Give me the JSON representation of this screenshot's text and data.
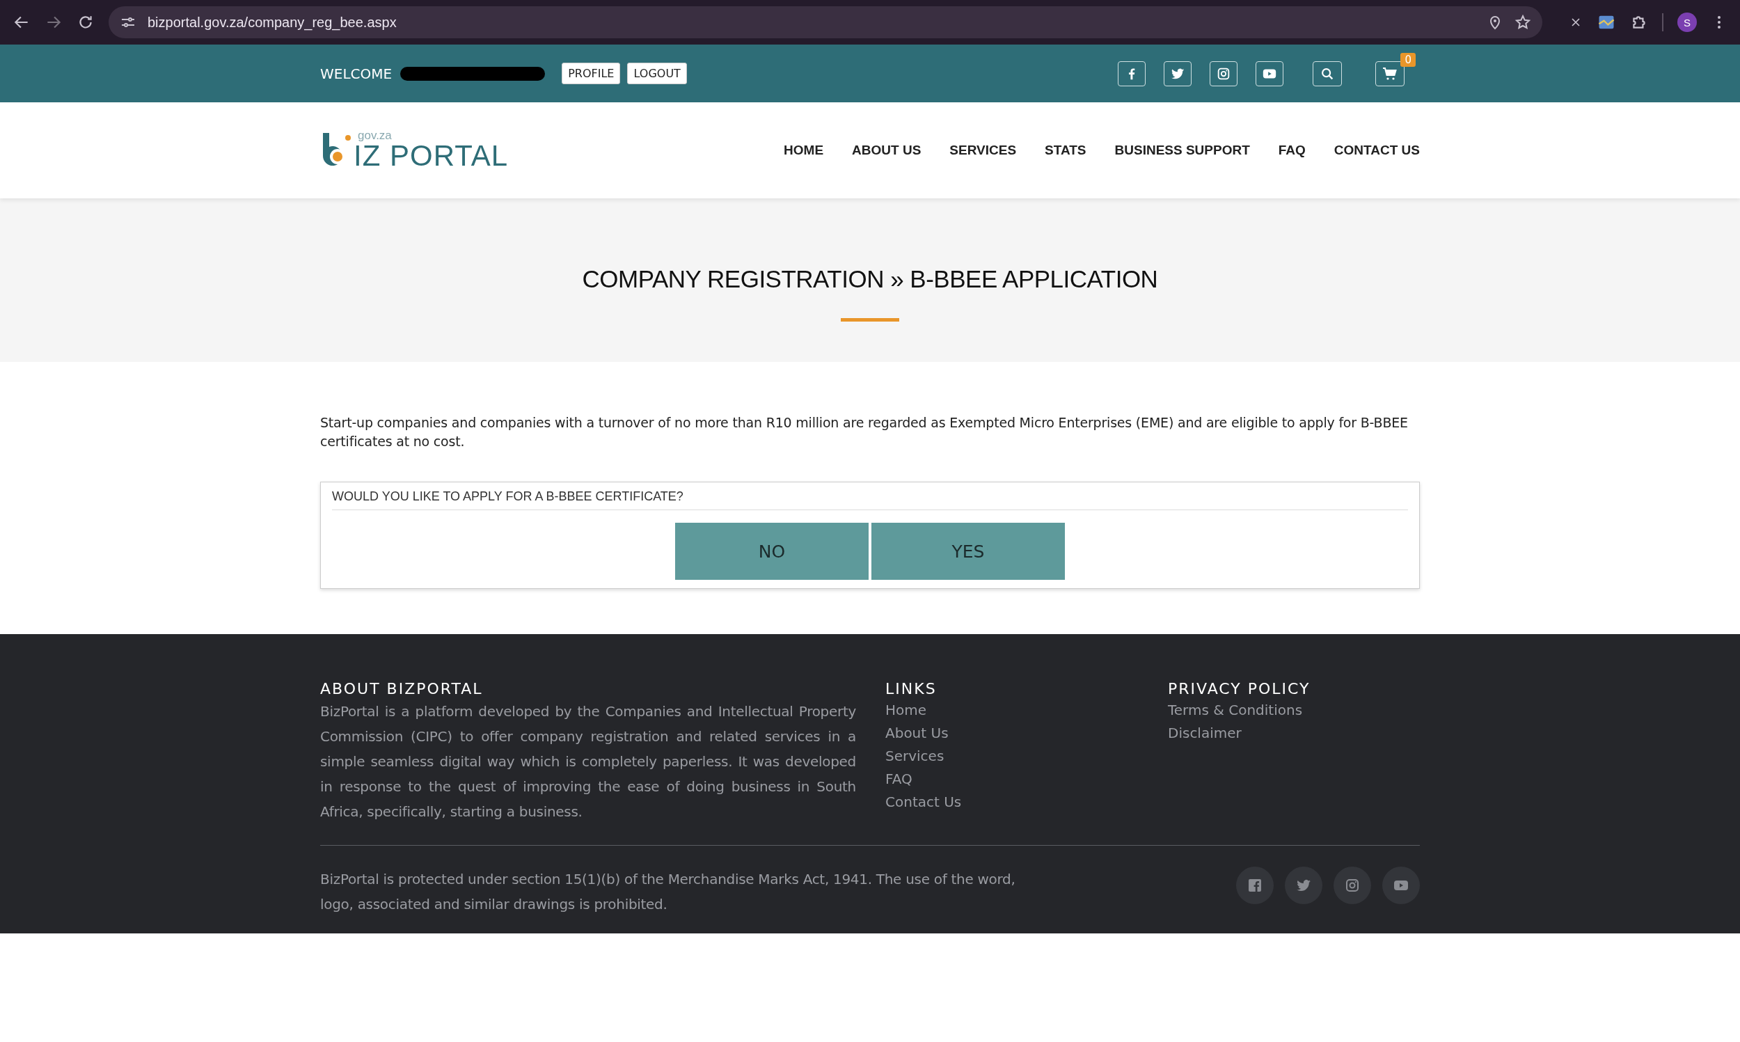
{
  "browser": {
    "url": "bizportal.gov.za/company_reg_bee.aspx",
    "profile_initial": "S"
  },
  "top_bar": {
    "welcome": "WELCOME",
    "buttons": [
      "PROFILE",
      "LOGOUT"
    ],
    "cart_count": "0"
  },
  "logo": {
    "domain": "gov.za",
    "name": "IZ PORTAL"
  },
  "nav": [
    "HOME",
    "ABOUT US",
    "SERVICES",
    "STATS",
    "BUSINESS SUPPORT",
    "FAQ",
    "CONTACT US"
  ],
  "page_title": "COMPANY REGISTRATION » B-BBEE APPLICATION",
  "intro": "Start-up companies and companies with a turnover of no more than R10 million are regarded as Exempted Micro Enterprises (EME) and are eligible to apply for B-BBEE certificates at no cost.",
  "question": {
    "label": "WOULD YOU LIKE TO APPLY FOR A B-BBEE CERTIFICATE?",
    "buttons": [
      "NO",
      "YES"
    ]
  },
  "footer": {
    "about": {
      "heading": "ABOUT BIZPORTAL",
      "text": "BizPortal is a platform developed by the Companies and Intellectual Property Commission (CIPC) to offer company registration and related services in a simple seamless digital way which is completely paperless. It was developed in response to the quest of improving the ease of doing business in South Africa, specifically, starting a business."
    },
    "links": {
      "heading": "LINKS",
      "items": [
        "Home",
        "About Us",
        "Services",
        "FAQ",
        "Contact Us"
      ]
    },
    "privacy": {
      "heading": "PRIVACY POLICY",
      "items": [
        "Terms & Conditions",
        "Disclaimer"
      ]
    },
    "legal": "BizPortal is protected under section 15(1)(b) of the Merchandise Marks Act, 1941. The use of the word, logo, associated and similar drawings is prohibited."
  }
}
